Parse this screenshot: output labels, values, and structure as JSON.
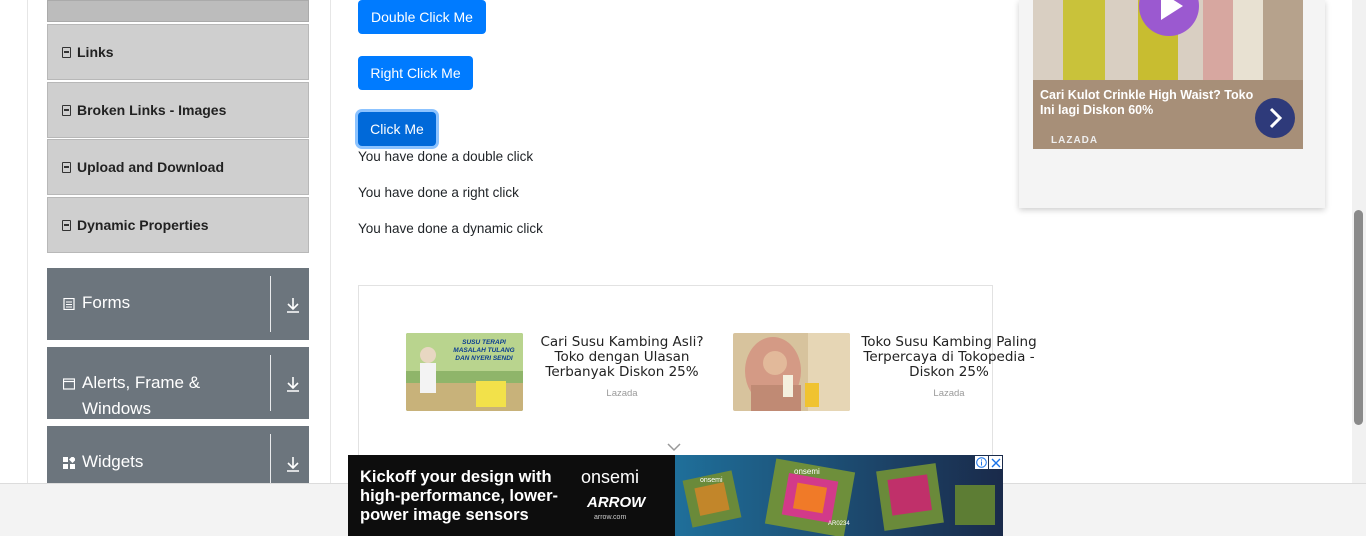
{
  "sidebar": {
    "items": [
      {
        "label": "Links"
      },
      {
        "label": "Broken Links - Images"
      },
      {
        "label": "Upload and Download"
      },
      {
        "label": "Dynamic Properties"
      }
    ],
    "groups": [
      {
        "label": "Forms"
      },
      {
        "label": "Alerts, Frame & Windows"
      },
      {
        "label": "Widgets"
      }
    ]
  },
  "buttons": {
    "double_click": "Double Click Me",
    "right_click": "Right Click Me",
    "click": "Click Me"
  },
  "messages": {
    "double": "You have done a double click",
    "right": "You have done a right click",
    "dynamic": "You have done a dynamic click"
  },
  "ads": {
    "cards": [
      {
        "title": "Cari Susu Kambing Asli? Toko dengan Ulasan Terbanyak Diskon 25%",
        "source": "Lazada",
        "image_text": "SUSU TERAPI MASALAH TULANG DAN NYERI SENDI"
      },
      {
        "title": "Toko Susu Kambing Paling Terpercaya di Tokopedia - Diskon 25%",
        "source": "Lazada"
      }
    ],
    "right_ad": {
      "caption": "Cari Kulot Crinkle High Waist? Toko Ini lagi Diskon 60%",
      "source": "LAZADA"
    },
    "banner": {
      "headline": "Kickoff your design with high-performance, lower-power image sensors",
      "brand1": "onsemi",
      "brand2": "ARROW",
      "brand2_sub": "arrow.com",
      "chip1": "onsemi",
      "chip2": "onsemi",
      "chip3": "AR0234"
    }
  }
}
